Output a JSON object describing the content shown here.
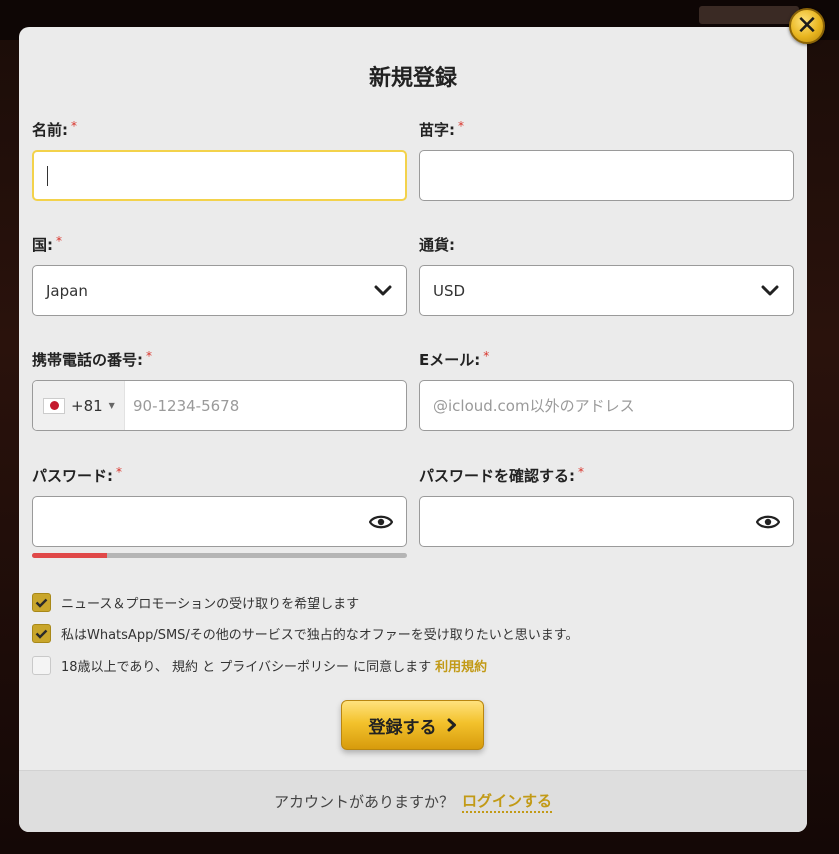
{
  "modal": {
    "title": "新規登録",
    "close_label": "✕"
  },
  "fields": {
    "first_name": {
      "label": "名前:",
      "required": "*",
      "value": ""
    },
    "last_name": {
      "label": "苗字:",
      "required": "*",
      "value": ""
    },
    "country": {
      "label": "国:",
      "required": "*",
      "value": "Japan"
    },
    "currency": {
      "label": "通貨:",
      "value": "USD"
    },
    "phone": {
      "label": "携帯電話の番号:",
      "required": "*",
      "dial_code": "+81",
      "placeholder": "90-1234-5678"
    },
    "email": {
      "label": "Eメール:",
      "required": "*",
      "placeholder": "@icloud.com以外のアドレス"
    },
    "password": {
      "label": "パスワード:",
      "required": "*",
      "strength": 0.2
    },
    "password_confirm": {
      "label": "パスワードを確認する:",
      "required": "*"
    }
  },
  "checkboxes": [
    {
      "text": "ニュース＆プロモーションの受け取りを希望します",
      "checked": true
    },
    {
      "text": "私はWhatsApp/SMS/その他のサービスで独占的なオファーを受け取りたいと思います。",
      "checked": true
    },
    {
      "text": "18歳以上であり、 規約 と プライバシーポリシー に同意します",
      "link": "利用規約",
      "checked": false
    }
  ],
  "submit": {
    "label": "登録する"
  },
  "footer": {
    "text": "アカウントがありますか？",
    "login_label": "ログインする"
  },
  "colors": {
    "accent": "#c9a62b",
    "required": "#d9342b",
    "strength_weak": "#e04848"
  }
}
